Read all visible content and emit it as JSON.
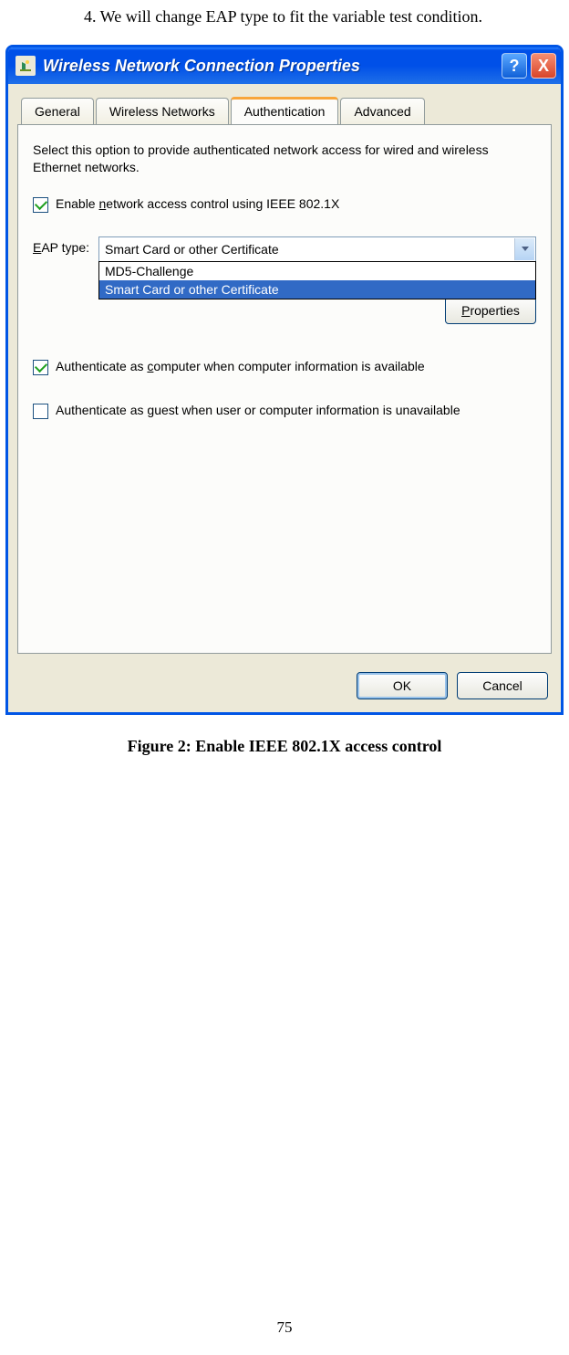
{
  "page": {
    "intro_text": "4. We will change EAP type to fit the variable test condition.",
    "figure_caption": "Figure 2: Enable IEEE 802.1X access control",
    "page_number": "75"
  },
  "dialog": {
    "title": "Wireless Network Connection Properties",
    "help_glyph": "?",
    "close_glyph": "X",
    "tabs": {
      "general": "General",
      "wireless": "Wireless Networks",
      "authentication": "Authentication",
      "advanced": "Advanced"
    },
    "active_tab": "authentication",
    "description": "Select this option to provide authenticated network access for wired and wireless Ethernet networks.",
    "enable_label_pre": "Enable ",
    "enable_label_u": "n",
    "enable_label_post": "etwork access control using IEEE 802.1X",
    "enable_checked": true,
    "eap_label_pre": "",
    "eap_label_u": "E",
    "eap_label_post": "AP type:",
    "eap_selected": "Smart Card or other Certificate",
    "eap_options": {
      "md5": "MD5-Challenge",
      "smartcard": "Smart Card or other Certificate"
    },
    "properties_btn": "Properties",
    "auth_computer_pre": "Authenticate as ",
    "auth_computer_u": "c",
    "auth_computer_post": "omputer when computer information is available",
    "auth_computer_checked": true,
    "auth_guest_pre": "Authenticate as ",
    "auth_guest_u": "g",
    "auth_guest_post": "uest when user or computer information is unavailable",
    "auth_guest_checked": false,
    "ok_btn": "OK",
    "cancel_btn": "Cancel"
  }
}
